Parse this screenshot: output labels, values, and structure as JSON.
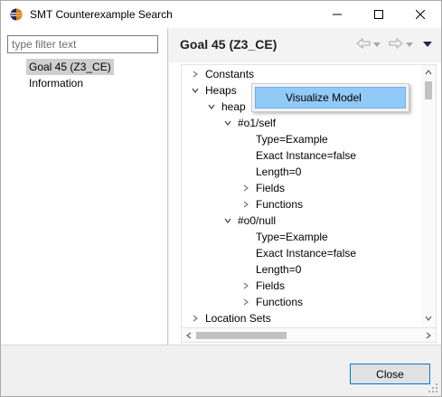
{
  "window": {
    "title": "SMT Counterexample Search"
  },
  "left_panel": {
    "filter_placeholder": "type filter text",
    "items": [
      {
        "label": "Goal 45 (Z3_CE)",
        "selected": true
      },
      {
        "label": "Information",
        "selected": false
      }
    ]
  },
  "right_panel": {
    "header_title": "Goal 45 (Z3_CE)",
    "tree": [
      {
        "label": "Constants",
        "state": "collapsed"
      },
      {
        "label": "Heaps",
        "state": "expanded"
      },
      {
        "label": "heap",
        "state": "expanded"
      },
      {
        "label": "#o1/self",
        "state": "expanded"
      },
      {
        "label": "Type=Example",
        "state": "leaf"
      },
      {
        "label": "Exact Instance=false",
        "state": "leaf"
      },
      {
        "label": "Length=0",
        "state": "leaf"
      },
      {
        "label": "Fields",
        "state": "collapsed"
      },
      {
        "label": "Functions",
        "state": "collapsed"
      },
      {
        "label": "#o0/null",
        "state": "expanded"
      },
      {
        "label": "Type=Example",
        "state": "leaf"
      },
      {
        "label": "Exact Instance=false",
        "state": "leaf"
      },
      {
        "label": "Length=0",
        "state": "leaf"
      },
      {
        "label": "Fields",
        "state": "collapsed"
      },
      {
        "label": "Functions",
        "state": "collapsed"
      },
      {
        "label": "Location Sets",
        "state": "collapsed"
      }
    ]
  },
  "context_menu": {
    "items": [
      {
        "label": "Visualize Model",
        "highlighted": true
      }
    ]
  },
  "footer": {
    "close_label": "Close"
  },
  "colors": {
    "selection_highlight": "#91c9f7",
    "button_focus_border": "#0078d7",
    "eclipse_icon": "#2c2255"
  }
}
